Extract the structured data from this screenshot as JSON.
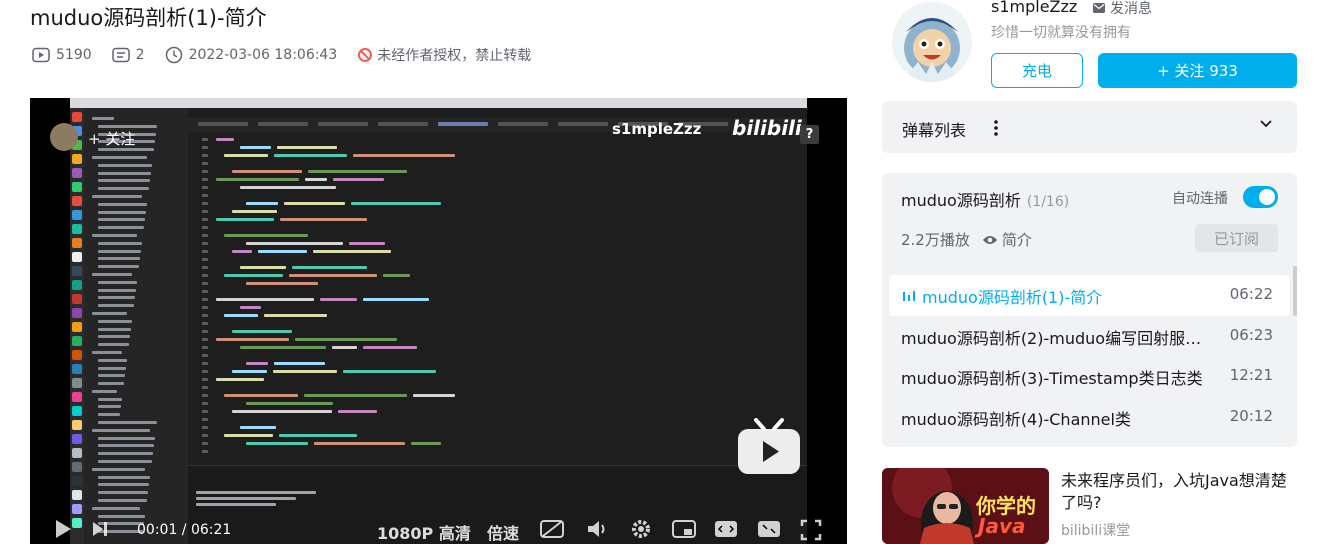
{
  "video": {
    "title": "muduo源码剖析(1)-简介",
    "views": "5190",
    "danmaku_count": "2",
    "pubdate": "2022-03-06 18:06:43",
    "copyright": "未经作者授权，禁止转载"
  },
  "player": {
    "watermark_name": "s1mpleZzz",
    "watermark_logo": "bilibili",
    "follow_label": "关注",
    "help_label": "?",
    "time_current": "00:01",
    "time_sep": " / ",
    "time_total": "06:21",
    "quality": "1080P 高清",
    "speed": "倍速"
  },
  "uploader": {
    "name": "s1mpleZzz",
    "message_label": "发消息",
    "signature": "珍惜一切就算没有拥有",
    "charge_label": "充电",
    "follow_label": "+ 关注 933"
  },
  "danmaku_panel": {
    "title": "弹幕列表"
  },
  "playlist": {
    "title": "muduo源码剖析",
    "progress": "(1/16)",
    "autoplay_label": "自动连播",
    "autoplay_on": true,
    "plays": "2.2万播放",
    "intro_label": "简介",
    "subscribed_label": "已订阅",
    "items": [
      {
        "title": "muduo源码剖析(1)-简介",
        "duration": "06:22",
        "active": true
      },
      {
        "title": "muduo源码剖析(2)-muduo编写回射服务器",
        "duration": "06:23"
      },
      {
        "title": "muduo源码剖析(3)-Timestamp类日志类",
        "duration": "12:21"
      },
      {
        "title": "muduo源码剖析(4)-Channel类",
        "duration": "20:12"
      }
    ]
  },
  "recommend": {
    "title": "未来程序员们，入坑Java想清楚了吗?",
    "author": "bilibili课堂",
    "thumb_text": "你学的",
    "thumb_text2": "Java"
  },
  "colors": {
    "accent": "#00aeec",
    "panel": "#f1f2f3",
    "text": "#18191c",
    "muted": "#61666d",
    "warn": "#f85a54"
  }
}
